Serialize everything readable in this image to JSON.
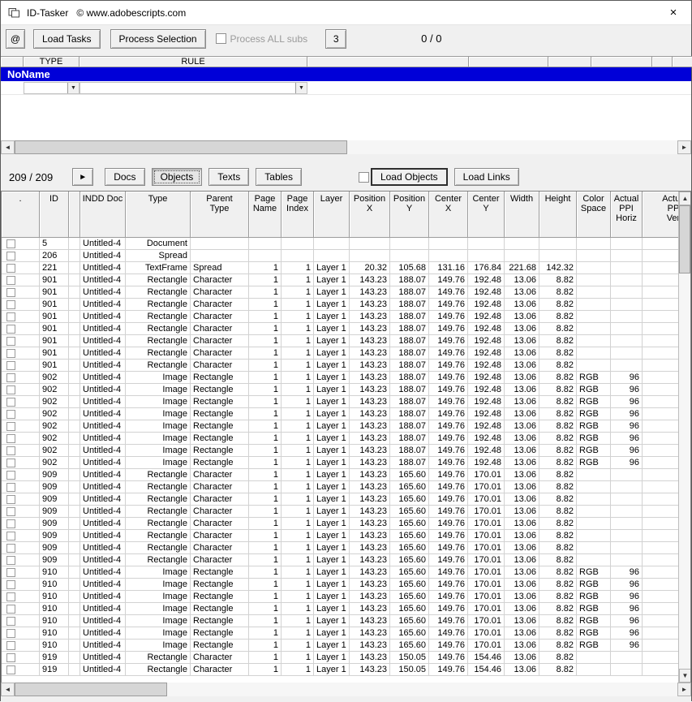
{
  "window": {
    "title": "ID-Tasker   © www.adobescripts.com",
    "close_glyph": "×"
  },
  "icons": {
    "left": "◄",
    "right": "►",
    "up": "▲",
    "down": "▼",
    "play": "►",
    "combo_arrow": "▼"
  },
  "toolbar": {
    "at_button": "@",
    "load_tasks": "Load Tasks",
    "process_selection": "Process Selection",
    "process_all_subs": "Process ALL subs",
    "batch_count": "3",
    "progress": "0 / 0"
  },
  "task_grid": {
    "col_type": "TYPE",
    "col_rule": "RULE",
    "selected_task": "NoName"
  },
  "nav": {
    "counter": "209 / 209",
    "tabs": {
      "docs": "Docs",
      "objects": "Objects",
      "texts": "Texts",
      "tables": "Tables"
    },
    "load_objects": "Load Objects",
    "load_links": "Load Links"
  },
  "table": {
    "columns": [
      ".",
      "ID",
      "",
      "INDD Doc",
      "Type",
      "Parent\nType",
      "Page\nName",
      "Page\nIndex",
      "Layer",
      "Position\nX",
      "Position\nY",
      "Center\nX",
      "Center\nY",
      "Width",
      "Height",
      "Color\nSpace",
      "Actual\nPPI\nHoriz",
      "Actual\nPPI\nVert"
    ],
    "rows": [
      [
        "5",
        "",
        "Untitled-4",
        "Document",
        "",
        "",
        "",
        "",
        "",
        "",
        "",
        "",
        "",
        "",
        "",
        "",
        ""
      ],
      [
        "206",
        "",
        "Untitled-4",
        "Spread",
        "",
        "",
        "",
        "",
        "",
        "",
        "",
        "",
        "",
        "",
        "",
        "",
        ""
      ],
      [
        "221",
        "",
        "Untitled-4",
        "TextFrame",
        "Spread",
        "1",
        "1",
        "Layer 1",
        "20.32",
        "105.68",
        "131.16",
        "176.84",
        "221.68",
        "142.32",
        "",
        "",
        ""
      ],
      [
        "901",
        "",
        "Untitled-4",
        "Rectangle",
        "Character",
        "1",
        "1",
        "Layer 1",
        "143.23",
        "188.07",
        "149.76",
        "192.48",
        "13.06",
        "8.82",
        "",
        "",
        ""
      ],
      [
        "901",
        "",
        "Untitled-4",
        "Rectangle",
        "Character",
        "1",
        "1",
        "Layer 1",
        "143.23",
        "188.07",
        "149.76",
        "192.48",
        "13.06",
        "8.82",
        "",
        "",
        ""
      ],
      [
        "901",
        "",
        "Untitled-4",
        "Rectangle",
        "Character",
        "1",
        "1",
        "Layer 1",
        "143.23",
        "188.07",
        "149.76",
        "192.48",
        "13.06",
        "8.82",
        "",
        "",
        ""
      ],
      [
        "901",
        "",
        "Untitled-4",
        "Rectangle",
        "Character",
        "1",
        "1",
        "Layer 1",
        "143.23",
        "188.07",
        "149.76",
        "192.48",
        "13.06",
        "8.82",
        "",
        "",
        ""
      ],
      [
        "901",
        "",
        "Untitled-4",
        "Rectangle",
        "Character",
        "1",
        "1",
        "Layer 1",
        "143.23",
        "188.07",
        "149.76",
        "192.48",
        "13.06",
        "8.82",
        "",
        "",
        ""
      ],
      [
        "901",
        "",
        "Untitled-4",
        "Rectangle",
        "Character",
        "1",
        "1",
        "Layer 1",
        "143.23",
        "188.07",
        "149.76",
        "192.48",
        "13.06",
        "8.82",
        "",
        "",
        ""
      ],
      [
        "901",
        "",
        "Untitled-4",
        "Rectangle",
        "Character",
        "1",
        "1",
        "Layer 1",
        "143.23",
        "188.07",
        "149.76",
        "192.48",
        "13.06",
        "8.82",
        "",
        "",
        ""
      ],
      [
        "901",
        "",
        "Untitled-4",
        "Rectangle",
        "Character",
        "1",
        "1",
        "Layer 1",
        "143.23",
        "188.07",
        "149.76",
        "192.48",
        "13.06",
        "8.82",
        "",
        "",
        ""
      ],
      [
        "902",
        "",
        "Untitled-4",
        "Image",
        "Rectangle",
        "1",
        "1",
        "Layer 1",
        "143.23",
        "188.07",
        "149.76",
        "192.48",
        "13.06",
        "8.82",
        "RGB",
        "96",
        ""
      ],
      [
        "902",
        "",
        "Untitled-4",
        "Image",
        "Rectangle",
        "1",
        "1",
        "Layer 1",
        "143.23",
        "188.07",
        "149.76",
        "192.48",
        "13.06",
        "8.82",
        "RGB",
        "96",
        ""
      ],
      [
        "902",
        "",
        "Untitled-4",
        "Image",
        "Rectangle",
        "1",
        "1",
        "Layer 1",
        "143.23",
        "188.07",
        "149.76",
        "192.48",
        "13.06",
        "8.82",
        "RGB",
        "96",
        ""
      ],
      [
        "902",
        "",
        "Untitled-4",
        "Image",
        "Rectangle",
        "1",
        "1",
        "Layer 1",
        "143.23",
        "188.07",
        "149.76",
        "192.48",
        "13.06",
        "8.82",
        "RGB",
        "96",
        ""
      ],
      [
        "902",
        "",
        "Untitled-4",
        "Image",
        "Rectangle",
        "1",
        "1",
        "Layer 1",
        "143.23",
        "188.07",
        "149.76",
        "192.48",
        "13.06",
        "8.82",
        "RGB",
        "96",
        ""
      ],
      [
        "902",
        "",
        "Untitled-4",
        "Image",
        "Rectangle",
        "1",
        "1",
        "Layer 1",
        "143.23",
        "188.07",
        "149.76",
        "192.48",
        "13.06",
        "8.82",
        "RGB",
        "96",
        ""
      ],
      [
        "902",
        "",
        "Untitled-4",
        "Image",
        "Rectangle",
        "1",
        "1",
        "Layer 1",
        "143.23",
        "188.07",
        "149.76",
        "192.48",
        "13.06",
        "8.82",
        "RGB",
        "96",
        ""
      ],
      [
        "902",
        "",
        "Untitled-4",
        "Image",
        "Rectangle",
        "1",
        "1",
        "Layer 1",
        "143.23",
        "188.07",
        "149.76",
        "192.48",
        "13.06",
        "8.82",
        "RGB",
        "96",
        ""
      ],
      [
        "909",
        "",
        "Untitled-4",
        "Rectangle",
        "Character",
        "1",
        "1",
        "Layer 1",
        "143.23",
        "165.60",
        "149.76",
        "170.01",
        "13.06",
        "8.82",
        "",
        "",
        ""
      ],
      [
        "909",
        "",
        "Untitled-4",
        "Rectangle",
        "Character",
        "1",
        "1",
        "Layer 1",
        "143.23",
        "165.60",
        "149.76",
        "170.01",
        "13.06",
        "8.82",
        "",
        "",
        ""
      ],
      [
        "909",
        "",
        "Untitled-4",
        "Rectangle",
        "Character",
        "1",
        "1",
        "Layer 1",
        "143.23",
        "165.60",
        "149.76",
        "170.01",
        "13.06",
        "8.82",
        "",
        "",
        ""
      ],
      [
        "909",
        "",
        "Untitled-4",
        "Rectangle",
        "Character",
        "1",
        "1",
        "Layer 1",
        "143.23",
        "165.60",
        "149.76",
        "170.01",
        "13.06",
        "8.82",
        "",
        "",
        ""
      ],
      [
        "909",
        "",
        "Untitled-4",
        "Rectangle",
        "Character",
        "1",
        "1",
        "Layer 1",
        "143.23",
        "165.60",
        "149.76",
        "170.01",
        "13.06",
        "8.82",
        "",
        "",
        ""
      ],
      [
        "909",
        "",
        "Untitled-4",
        "Rectangle",
        "Character",
        "1",
        "1",
        "Layer 1",
        "143.23",
        "165.60",
        "149.76",
        "170.01",
        "13.06",
        "8.82",
        "",
        "",
        ""
      ],
      [
        "909",
        "",
        "Untitled-4",
        "Rectangle",
        "Character",
        "1",
        "1",
        "Layer 1",
        "143.23",
        "165.60",
        "149.76",
        "170.01",
        "13.06",
        "8.82",
        "",
        "",
        ""
      ],
      [
        "909",
        "",
        "Untitled-4",
        "Rectangle",
        "Character",
        "1",
        "1",
        "Layer 1",
        "143.23",
        "165.60",
        "149.76",
        "170.01",
        "13.06",
        "8.82",
        "",
        "",
        ""
      ],
      [
        "910",
        "",
        "Untitled-4",
        "Image",
        "Rectangle",
        "1",
        "1",
        "Layer 1",
        "143.23",
        "165.60",
        "149.76",
        "170.01",
        "13.06",
        "8.82",
        "RGB",
        "96",
        ""
      ],
      [
        "910",
        "",
        "Untitled-4",
        "Image",
        "Rectangle",
        "1",
        "1",
        "Layer 1",
        "143.23",
        "165.60",
        "149.76",
        "170.01",
        "13.06",
        "8.82",
        "RGB",
        "96",
        ""
      ],
      [
        "910",
        "",
        "Untitled-4",
        "Image",
        "Rectangle",
        "1",
        "1",
        "Layer 1",
        "143.23",
        "165.60",
        "149.76",
        "170.01",
        "13.06",
        "8.82",
        "RGB",
        "96",
        ""
      ],
      [
        "910",
        "",
        "Untitled-4",
        "Image",
        "Rectangle",
        "1",
        "1",
        "Layer 1",
        "143.23",
        "165.60",
        "149.76",
        "170.01",
        "13.06",
        "8.82",
        "RGB",
        "96",
        ""
      ],
      [
        "910",
        "",
        "Untitled-4",
        "Image",
        "Rectangle",
        "1",
        "1",
        "Layer 1",
        "143.23",
        "165.60",
        "149.76",
        "170.01",
        "13.06",
        "8.82",
        "RGB",
        "96",
        ""
      ],
      [
        "910",
        "",
        "Untitled-4",
        "Image",
        "Rectangle",
        "1",
        "1",
        "Layer 1",
        "143.23",
        "165.60",
        "149.76",
        "170.01",
        "13.06",
        "8.82",
        "RGB",
        "96",
        ""
      ],
      [
        "910",
        "",
        "Untitled-4",
        "Image",
        "Rectangle",
        "1",
        "1",
        "Layer 1",
        "143.23",
        "165.60",
        "149.76",
        "170.01",
        "13.06",
        "8.82",
        "RGB",
        "96",
        ""
      ],
      [
        "919",
        "",
        "Untitled-4",
        "Rectangle",
        "Character",
        "1",
        "1",
        "Layer 1",
        "143.23",
        "150.05",
        "149.76",
        "154.46",
        "13.06",
        "8.82",
        "",
        "",
        ""
      ],
      [
        "919",
        "",
        "Untitled-4",
        "Rectangle",
        "Character",
        "1",
        "1",
        "Layer 1",
        "143.23",
        "150.05",
        "149.76",
        "154.46",
        "13.06",
        "8.82",
        "",
        "",
        ""
      ]
    ]
  }
}
